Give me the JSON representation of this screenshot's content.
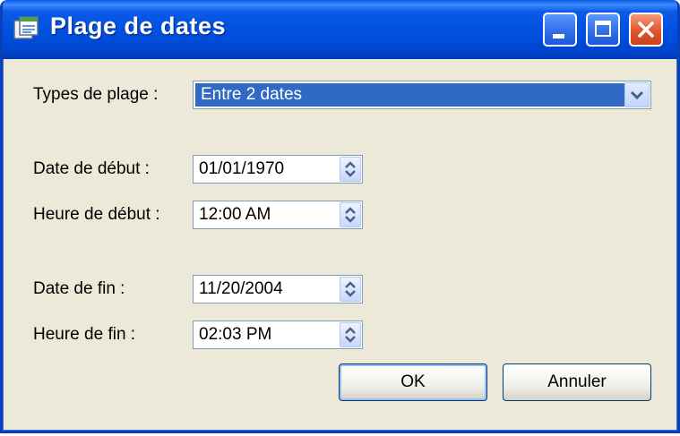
{
  "window": {
    "title": "Plage de dates"
  },
  "range": {
    "label": "Types de plage :",
    "selected": "Entre 2 dates"
  },
  "start": {
    "date_label": "Date de début :",
    "date_value": "01/01/1970",
    "time_label": "Heure de début :",
    "time_value": "12:00 AM"
  },
  "end": {
    "date_label": "Date de fin :",
    "date_value": "11/20/2004",
    "time_label": "Heure de fin :",
    "time_value": "02:03 PM"
  },
  "buttons": {
    "ok": "OK",
    "cancel": "Annuler"
  },
  "icons": {
    "app": "calendar-range-icon",
    "minimize": "minimize-icon",
    "maximize": "maximize-icon",
    "close": "close-icon"
  },
  "colors": {
    "title_bar": "#0050e0",
    "selection": "#316ac5",
    "dialog_bg": "#ece9d8",
    "close_button": "#e1552e"
  }
}
